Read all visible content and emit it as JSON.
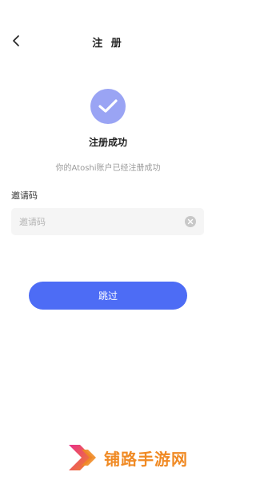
{
  "header": {
    "title": "注 册"
  },
  "success": {
    "title": "注册成功",
    "subtitle": "你的Atoshi账户已经注册成功"
  },
  "invite": {
    "label": "邀请码",
    "placeholder": "邀请码",
    "value": ""
  },
  "actions": {
    "skip_label": "跳过"
  },
  "watermark": {
    "text": "铺路手游网"
  },
  "colors": {
    "accent": "#4d6cf5",
    "success_circle": "#9aa4f4",
    "watermark": "#f08a24"
  }
}
